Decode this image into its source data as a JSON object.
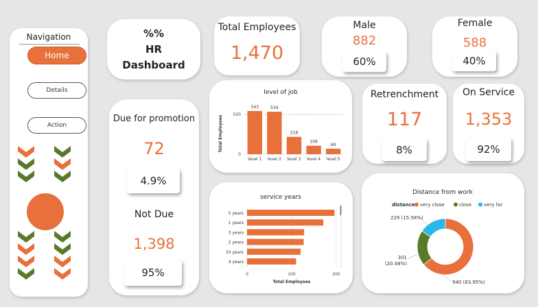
{
  "navigation": {
    "title": "Navigation",
    "items": [
      {
        "label": "Home",
        "active": true
      },
      {
        "label": "Details",
        "active": false
      },
      {
        "label": "Action",
        "active": false
      }
    ]
  },
  "header": {
    "line1": "%%",
    "line2": "HR",
    "line3": "Dashboard"
  },
  "total_employees": {
    "label": "Total Employees",
    "value": "1,470"
  },
  "male": {
    "label": "Male",
    "value": "882",
    "pct": "60%"
  },
  "female": {
    "label": "Female",
    "value": "588",
    "pct": "40%"
  },
  "promotion": {
    "due_label": "Due for promotion",
    "due_value": "72",
    "due_pct": "4.9%",
    "not_due_label": "Not Due",
    "not_due_value": "1,398",
    "not_due_pct": "95%"
  },
  "retrenchment": {
    "label": "Retrenchment",
    "value": "117",
    "pct": "8%"
  },
  "on_service": {
    "label": "On Service",
    "value": "1,353",
    "pct": "92%"
  },
  "colors": {
    "accent": "#e8703a",
    "green": "#5a7a2a",
    "blue": "#2ab6e8"
  },
  "chart_data": [
    {
      "type": "bar",
      "title": "level of job",
      "ylabel": "Total Employees",
      "categories": [
        "level 1",
        "level 2",
        "level 3",
        "level 4",
        "level 5"
      ],
      "values": [
        543,
        534,
        218,
        106,
        69
      ],
      "yticks": [
        0,
        500
      ],
      "ylim": [
        0,
        600
      ],
      "grid": false
    },
    {
      "type": "bar",
      "orientation": "horizontal",
      "title": "service years",
      "xlabel": "Total Employees",
      "categories": [
        "5 years",
        "1 years",
        "3 years",
        "2 years",
        "10 years",
        "4 years"
      ],
      "values": [
        196,
        171,
        128,
        127,
        120,
        110
      ],
      "xticks": [
        0,
        100,
        200
      ],
      "xlim": [
        0,
        210
      ]
    },
    {
      "type": "pie",
      "donut": true,
      "title": "Distance from work",
      "legend_title": "distance",
      "legend_position": "top",
      "slices": [
        {
          "name": "very close",
          "value": 940,
          "label": "940 (63.95%)",
          "color": "#e8703a"
        },
        {
          "name": "close",
          "value": 301,
          "label": "301 (20.48%)",
          "color": "#5a7a2a"
        },
        {
          "name": "very far",
          "value": 229,
          "label": "229 (15.58%)",
          "color": "#2ab6e8"
        }
      ]
    }
  ]
}
